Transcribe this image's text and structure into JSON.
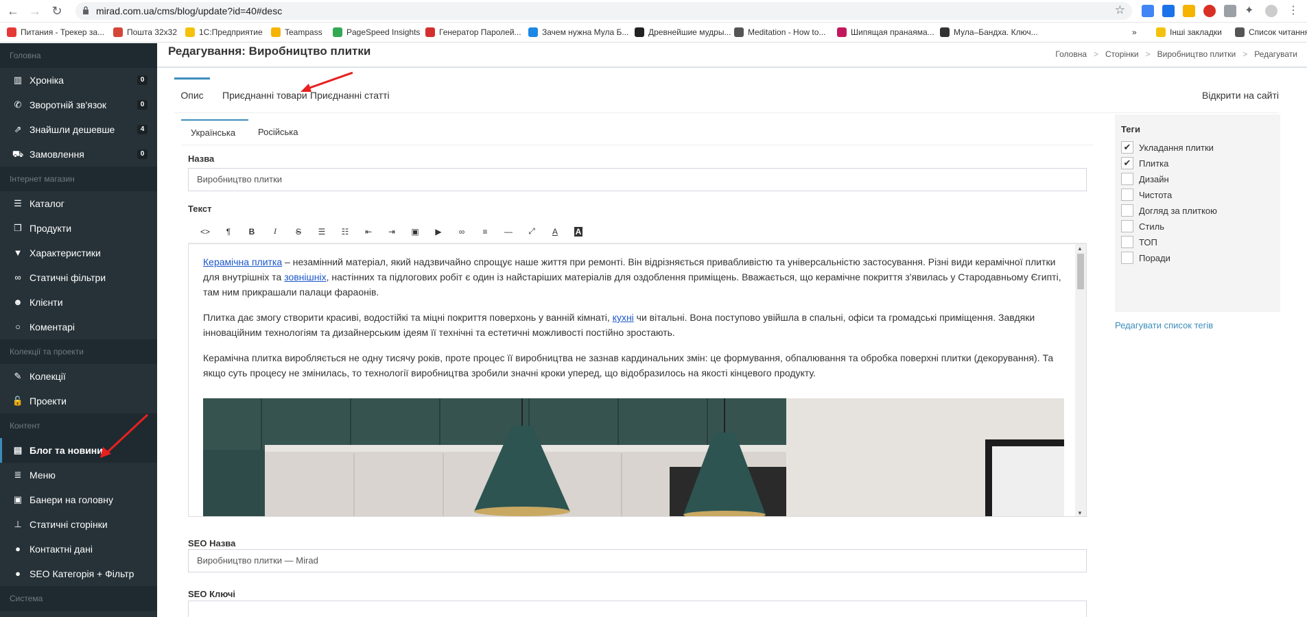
{
  "browser": {
    "url": "mirad.com.ua/cms/blog/update?id=40#desc",
    "bookmarks": [
      {
        "label": "Питания - Трекер за...",
        "color": "#e53935"
      },
      {
        "label": "Пошта 32x32",
        "color": "#d44638"
      },
      {
        "label": "1С:Предприятие",
        "color": "#f4c20d"
      },
      {
        "label": "Teampass",
        "color": "#f5b400"
      },
      {
        "label": "PageSpeed Insights",
        "color": "#34a853"
      },
      {
        "label": "Генератор Паролей...",
        "color": "#d32f2f"
      },
      {
        "label": "Зачем нужна Мула Б...",
        "color": "#1e88e5"
      },
      {
        "label": "Древнейшие мудры...",
        "color": "#222222"
      },
      {
        "label": "Meditation - How to...",
        "color": "#555555"
      },
      {
        "label": "Шипящая пранаяма...",
        "color": "#c2185b"
      },
      {
        "label": "Мула–Бандха. Ключ...",
        "color": "#333333"
      },
      {
        "label": "Інші закладки",
        "color": "#f4c20d"
      },
      {
        "label": "Список читання",
        "color": "#555555"
      }
    ]
  },
  "sidebar": {
    "sections": [
      {
        "title": "Головна",
        "items": [
          {
            "label": "Хроніка",
            "icon": "chart-icon",
            "badge": "0"
          },
          {
            "label": "Зворотній зв'язок",
            "icon": "phone-icon",
            "badge": "0"
          },
          {
            "label": "Знайшли дешевше",
            "icon": "external-link-icon",
            "badge": "4"
          },
          {
            "label": "Замовлення",
            "icon": "cart-icon",
            "badge": "0"
          }
        ]
      },
      {
        "title": "Інтернет магазин",
        "items": [
          {
            "label": "Каталог",
            "icon": "list-icon"
          },
          {
            "label": "Продукти",
            "icon": "cube-icon"
          },
          {
            "label": "Характеристики",
            "icon": "filter-icon"
          },
          {
            "label": "Статичні фільтри",
            "icon": "link-icon"
          },
          {
            "label": "Клієнти",
            "icon": "users-icon"
          },
          {
            "label": "Коментарі",
            "icon": "comment-icon"
          }
        ]
      },
      {
        "title": "Колекції та проекти",
        "items": [
          {
            "label": "Колекції",
            "icon": "wand-icon"
          },
          {
            "label": "Проекти",
            "icon": "unlock-icon"
          }
        ]
      },
      {
        "title": "Контент",
        "items": [
          {
            "label": "Блог та новини",
            "icon": "newspaper-icon",
            "active": true
          },
          {
            "label": "Меню",
            "icon": "menu-icon"
          },
          {
            "label": "Банери на головну",
            "icon": "image-icon"
          },
          {
            "label": "Статичні сторінки",
            "icon": "pin-icon"
          },
          {
            "label": "Контактні дані",
            "icon": "info-icon"
          },
          {
            "label": "SEO Категорія + Фільтр",
            "icon": "info-icon"
          }
        ]
      },
      {
        "title": "Система",
        "items": []
      }
    ]
  },
  "header": {
    "title": "Редагування: Виробництво плитки",
    "breadcrumbs": [
      "Головна",
      "Сторінки",
      "Виробництво плитки",
      "Редагувати"
    ]
  },
  "tabs": [
    "Опис",
    "Приєднанні товари",
    "Приєднанні статті"
  ],
  "open_site": "Відкрити на сайті",
  "langs": [
    "Українська",
    "Російська"
  ],
  "form": {
    "name_label": "Назва",
    "name_value": "Виробництво плитки",
    "text_label": "Текст",
    "seo_name_label": "SEO Назва",
    "seo_name_value": "Виробництво плитки — Mirad",
    "seo_keys_label": "SEO Ключі"
  },
  "editor": {
    "p1_link1": "Керамічна плитка",
    "p1_a": " – незамінний матеріал, який надзвичайно спрощує наше життя при ремонті. Він відрізняється привабливістю та універсальністю застосування. Різні види керамічної плитки для внутрішніх та ",
    "p1_link2": "зовнішніх",
    "p1_b": ", настінних та підлогових робіт є один із найстаріших матеріалів для оздоблення приміщень. Вважається, що керамічне покриття з'явилась у Стародавньому Єгипті, там ним прикрашали палаци фараонів.",
    "p2_a": "Плитка дає змогу створити красиві, водостійкі та міцні покриття поверхонь у ванній кімнаті, ",
    "p2_link": "кухні",
    "p2_b": " чи вітальні. Вона поступово увійшла в спальні, офіси та громадські приміщення. Завдяки інноваційним технологіям та дизайнерським ідеям її технічні та естетичні можливості постійно зростають.",
    "p3": "Керамічна плитка виробляється не одну тисячу років, проте процес її виробництва не зазнав кардинальних змін: це формування, обпалювання та обробка поверхні плитки (декорування). Та якщо суть процесу не змінилась, то технології виробництва зробили значні кроки уперед, що відобразилось на якості кінцевого продукту."
  },
  "tags": {
    "title": "Теги",
    "items": [
      {
        "label": "Укладання плитки",
        "checked": true
      },
      {
        "label": "Плитка",
        "checked": true
      },
      {
        "label": "Дизайн",
        "checked": false
      },
      {
        "label": "Чистота",
        "checked": false
      },
      {
        "label": "Догляд за плиткою",
        "checked": false
      },
      {
        "label": "Стиль",
        "checked": false
      },
      {
        "label": "ТОП",
        "checked": false
      },
      {
        "label": "Поради",
        "checked": false
      }
    ],
    "edit_link": "Редагувати список тегів"
  },
  "colors": {
    "sidebar_bg": "#263238",
    "accent": "#3c8dbc",
    "annotation_arrow": "#e82020"
  }
}
